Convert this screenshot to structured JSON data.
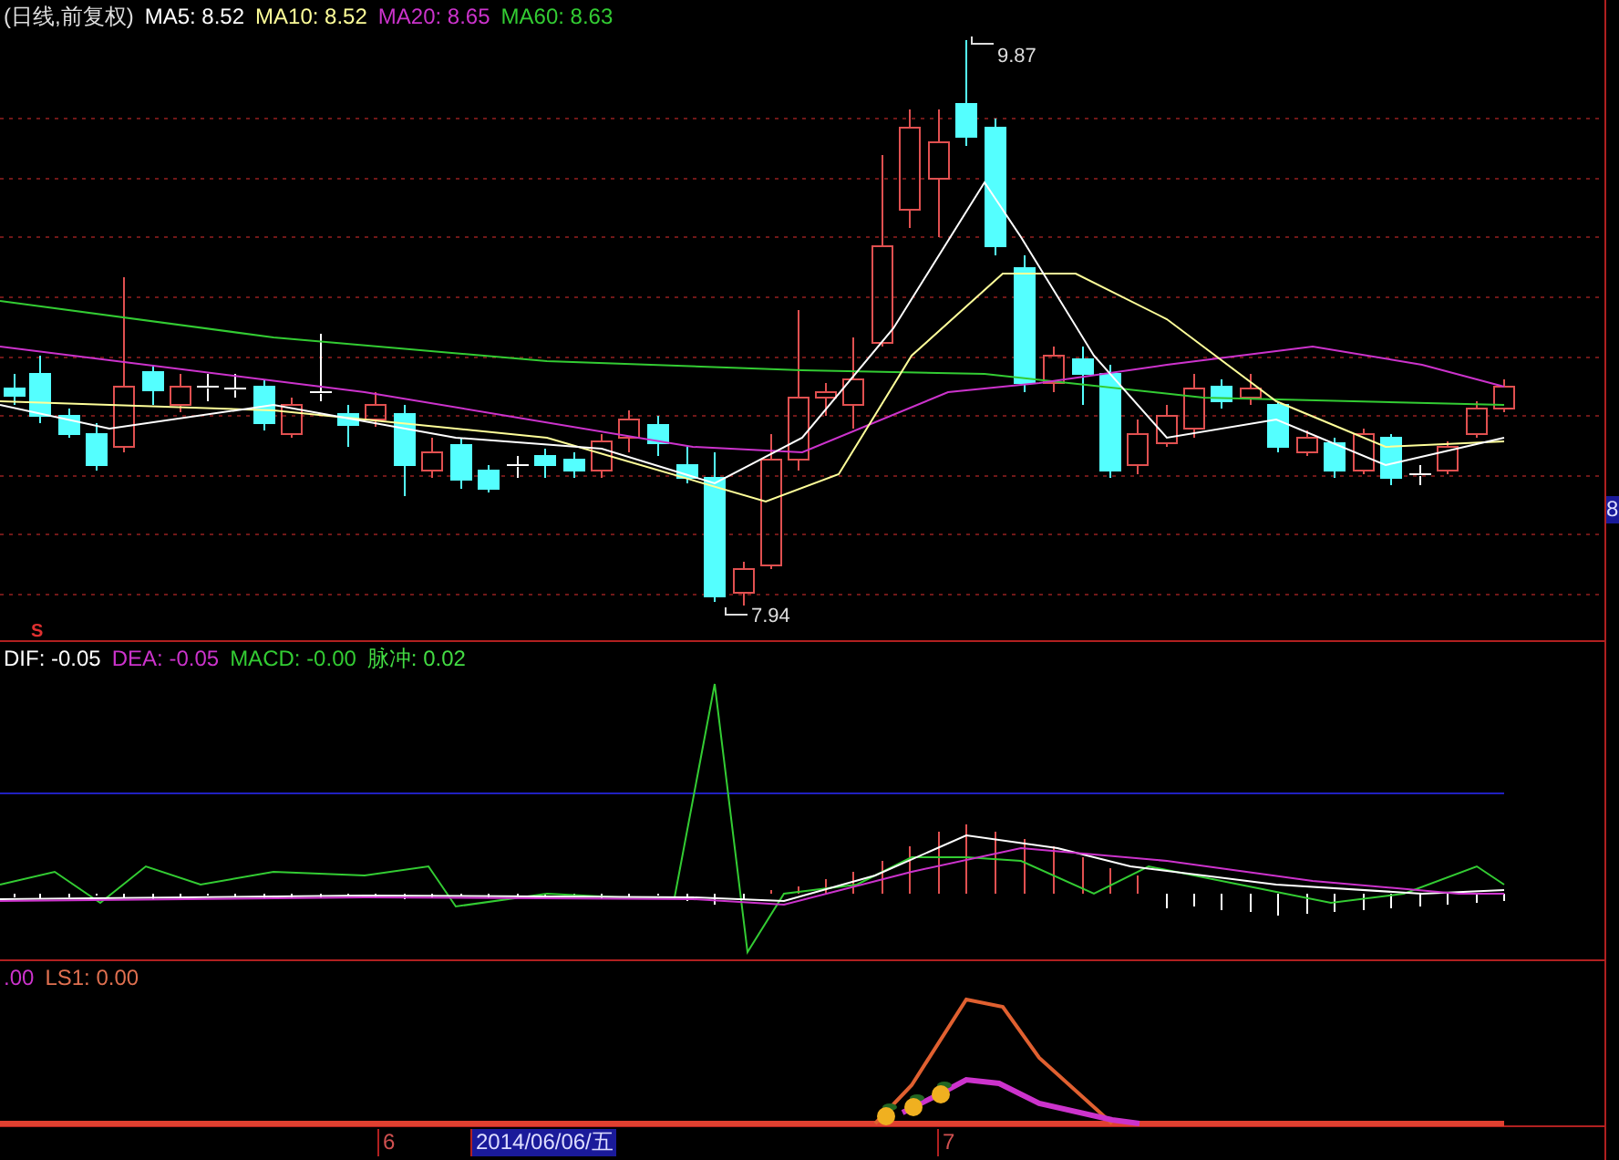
{
  "main_panel": {
    "title": "(日线,前复权)",
    "indicators": [
      {
        "label": "MA5: 8.52",
        "color": "#ffffff"
      },
      {
        "label": "MA10: 8.52",
        "color": "#ffff99"
      },
      {
        "label": "MA20: 8.65",
        "color": "#cc33cc"
      },
      {
        "label": "MA60: 8.63",
        "color": "#33cc33"
      }
    ],
    "high_marker": "9.87",
    "low_marker": "7.94",
    "signal_marker": "S"
  },
  "macd_panel": {
    "indicators": [
      {
        "label": "DIF: -0.05",
        "color": "#ffffff"
      },
      {
        "label": "DEA: -0.05",
        "color": "#cc33cc"
      },
      {
        "label": "MACD: -0.00",
        "color": "#33cc33"
      },
      {
        "label": "脉冲: 0.02",
        "color": "#44dd44"
      }
    ]
  },
  "ls_panel": {
    "indicators": [
      {
        "label": ".00",
        "color": "#cc33cc"
      },
      {
        "label": "LS1: 0.00",
        "color": "#e07050"
      }
    ]
  },
  "time_axis": [
    {
      "label": "6",
      "selected": false
    },
    {
      "label": "2014/06/06/五",
      "selected": true
    },
    {
      "label": "7",
      "selected": false
    }
  ],
  "price_axis": {
    "label": "8"
  }
}
